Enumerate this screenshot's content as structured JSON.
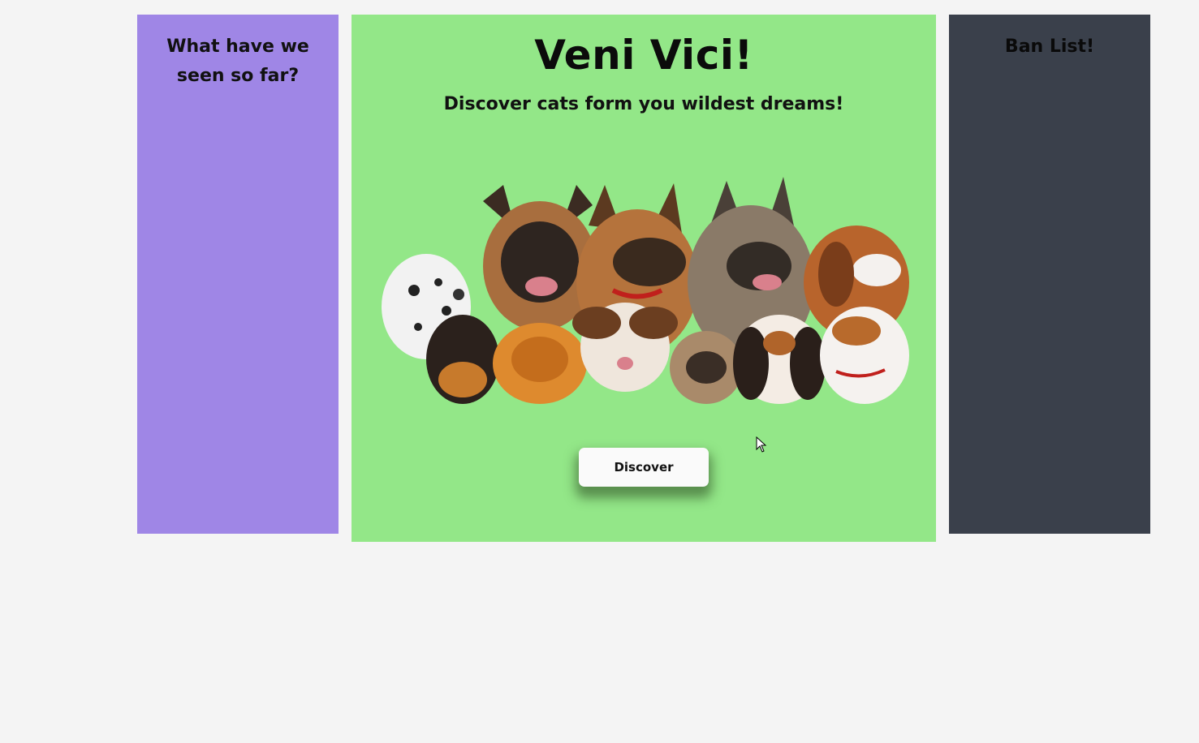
{
  "history": {
    "title": "What have we seen so far?"
  },
  "main": {
    "title": "Veni Vici!",
    "subtitle": "Discover cats form you wildest dreams!",
    "discover_label": "Discover"
  },
  "banlist": {
    "title": "Ban List!"
  },
  "colors": {
    "history_bg": "#9f86e6",
    "main_bg": "#93e788",
    "banlist_bg": "#3a404b",
    "page_bg": "#f4f4f4"
  },
  "image": {
    "icon": "dog-group-illustration"
  }
}
